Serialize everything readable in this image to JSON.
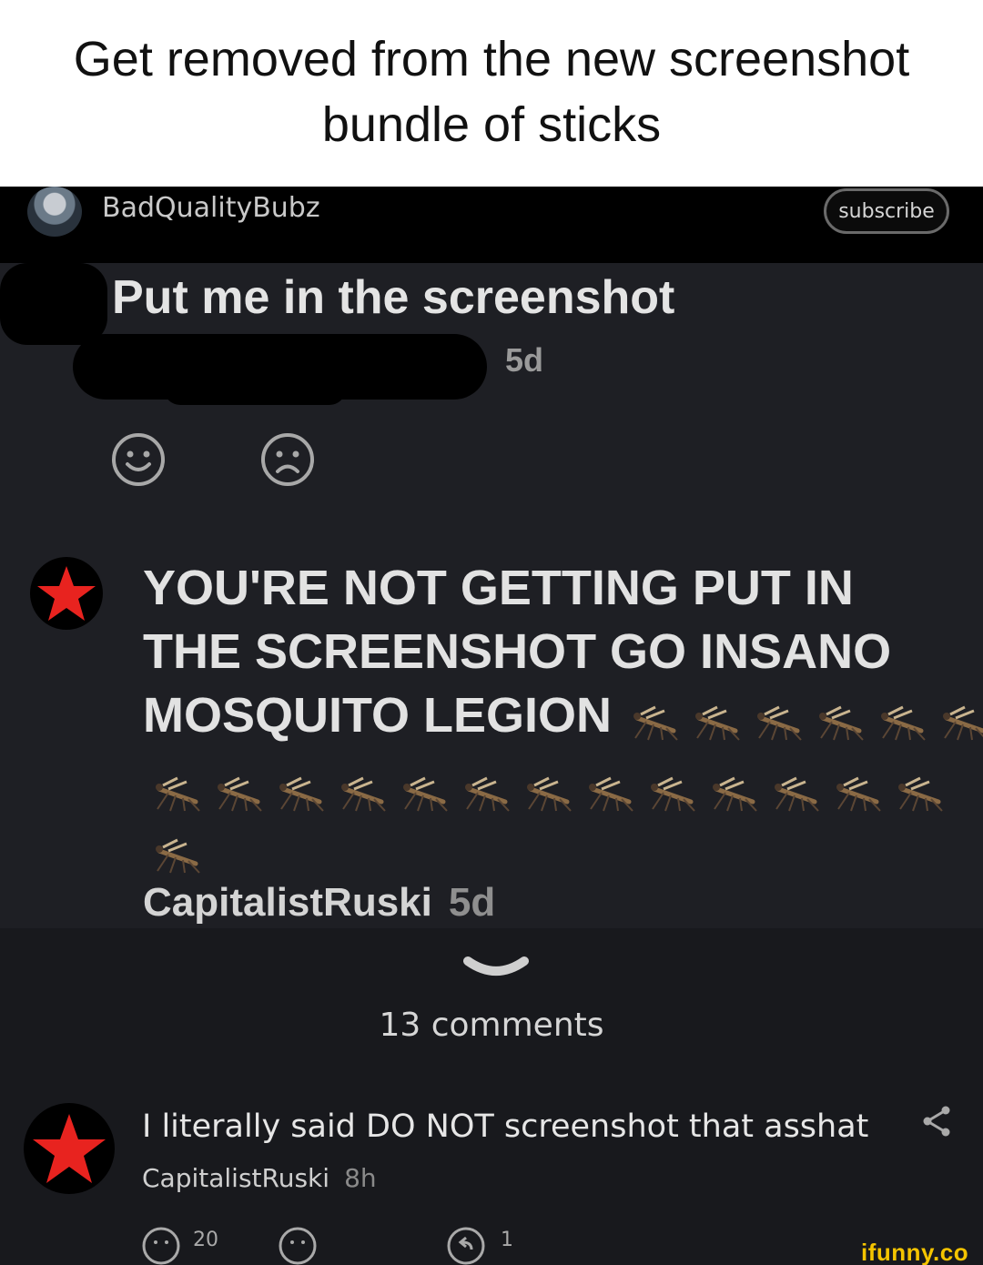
{
  "caption": "Get removed from the new screenshot bundle of sticks",
  "header": {
    "username": "BadQualityBubz",
    "subscribe_label": "subscribe"
  },
  "post": {
    "title": "Put me in the screenshot",
    "age": "5d",
    "reactions": [
      "smile-icon",
      "frown-icon"
    ]
  },
  "reply": {
    "text": "YOU'RE NOT GETTING PUT IN THE SCREENSHOT GO INSANO MOSQUITO LEGION",
    "mosquito_count": 20,
    "author": "CapitalistRuski",
    "age": "5d"
  },
  "comments": {
    "count_label": "13 comments",
    "items": [
      {
        "text": "I literally said DO NOT screenshot that asshat",
        "author": "CapitalistRuski",
        "age": "8h",
        "smile_count": "20",
        "reply_count": "1"
      }
    ]
  },
  "watermark": "ifunny.co",
  "colors": {
    "star_red": "#e8231f",
    "watermark_yellow": "#f4c400",
    "dark_bg": "#1e1f24"
  }
}
